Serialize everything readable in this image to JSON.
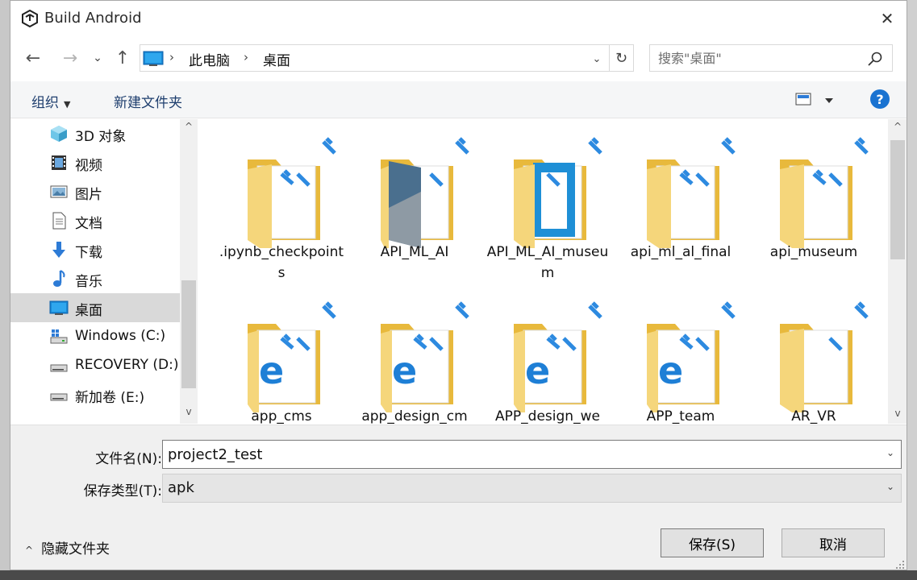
{
  "window": {
    "title": "Build Android",
    "close_glyph": "✕"
  },
  "nav": {
    "back_glyph": "←",
    "forward_glyph": "→",
    "recent_glyph": "⌄",
    "up_glyph": "↑",
    "breadcrumb": [
      "此电脑",
      "桌面"
    ],
    "separator": "›",
    "address_dropdown_glyph": "⌄",
    "refresh_glyph": "↻",
    "search_placeholder": "搜索\"桌面\""
  },
  "toolbar": {
    "organize_label": "组织",
    "organize_arrow": "▼",
    "new_folder_label": "新建文件夹",
    "help_label": "?"
  },
  "sidebar": {
    "items": [
      {
        "label": "3D 对象",
        "icon": "3d-objects-icon"
      },
      {
        "label": "视频",
        "icon": "video-icon"
      },
      {
        "label": "图片",
        "icon": "pictures-icon"
      },
      {
        "label": "文档",
        "icon": "documents-icon"
      },
      {
        "label": "下载",
        "icon": "download-icon"
      },
      {
        "label": "音乐",
        "icon": "music-icon"
      },
      {
        "label": "桌面",
        "icon": "desktop-icon",
        "selected": true
      },
      {
        "label": "Windows (C:)",
        "icon": "windows-drive-icon"
      },
      {
        "label": "RECOVERY (D:)",
        "icon": "drive-icon"
      },
      {
        "label": "新加卷 (E:)",
        "icon": "drive-icon"
      }
    ],
    "scroll_up_glyph": "^",
    "scroll_down_glyph": "v"
  },
  "files": {
    "items": [
      {
        "label": ".ipynb_checkpoints",
        "icon": "folder-icon"
      },
      {
        "label": "API_ML_AI",
        "icon": "folder-image-icon"
      },
      {
        "label": "API_ML_AI_museum",
        "icon": "folder-blue-doc-icon"
      },
      {
        "label": "api_ml_al_final",
        "icon": "folder-icon"
      },
      {
        "label": "api_museum",
        "icon": "folder-icon"
      },
      {
        "label": "app_cms",
        "icon": "folder-edge-icon"
      },
      {
        "label": "app_design_cm",
        "icon": "folder-edge-icon"
      },
      {
        "label": "APP_design_we",
        "icon": "folder-edge-icon"
      },
      {
        "label": "APP_team",
        "icon": "folder-edge-icon"
      },
      {
        "label": "AR_VR",
        "icon": "folder-icon"
      }
    ],
    "scroll_up_glyph": "^",
    "scroll_down_glyph": "v"
  },
  "form": {
    "filename_label": "文件名(N):",
    "filename_value": "project2_test",
    "filetype_label": "保存类型(T):",
    "filetype_value": "apk",
    "dropdown_glyph": "⌄",
    "hide_folders_arrow": "^",
    "hide_folders_label": "隐藏文件夹",
    "save_label": "保存(S)",
    "cancel_label": "取消"
  },
  "colors": {
    "folder_yellow": "#f5d67b",
    "folder_dark": "#e8b93c",
    "accent_blue": "#1a73d1",
    "selected_bg": "#d9d9d9"
  }
}
